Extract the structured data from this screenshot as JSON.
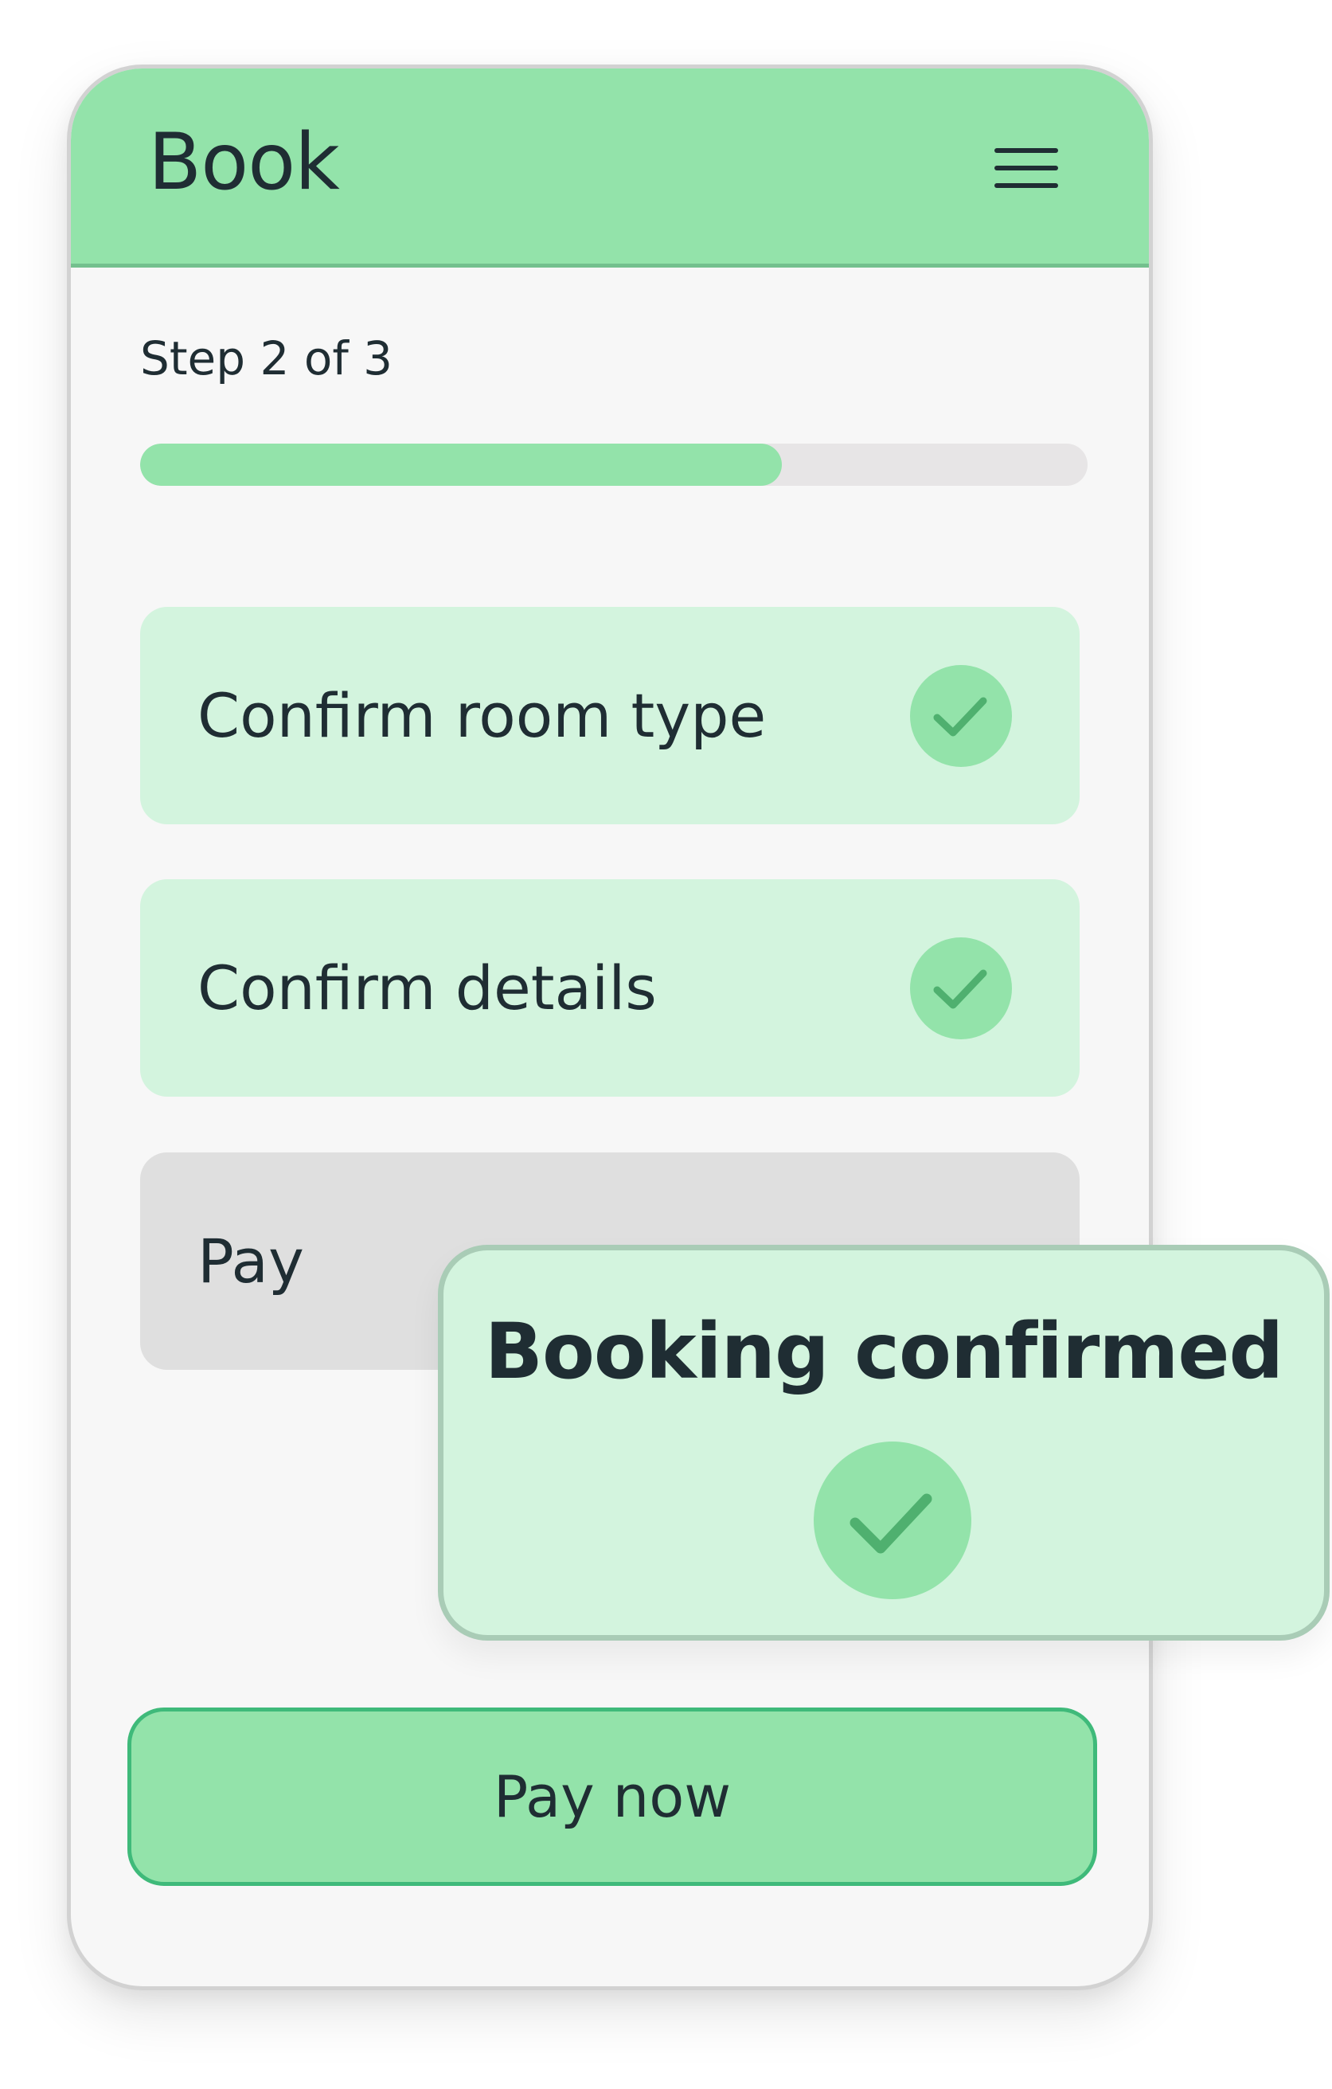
{
  "header": {
    "title": "Book",
    "menu_icon": "hamburger-menu-icon"
  },
  "progress": {
    "label": "Step 2 of 3",
    "current_step": 2,
    "total_steps": 3,
    "fill_fraction": 0.677
  },
  "steps": [
    {
      "label": "Confirm room type",
      "status": "complete",
      "icon": "check-icon"
    },
    {
      "label": "Confirm details",
      "status": "complete",
      "icon": "check-icon"
    },
    {
      "label": "Pay",
      "status": "pending"
    }
  ],
  "toast": {
    "title": "Booking confirmed",
    "icon": "check-icon"
  },
  "primary_action": {
    "label": "Pay now"
  },
  "colors": {
    "accent_green": "#93e3aa",
    "light_green": "#d3f4de",
    "check_stroke": "#4fb06f",
    "button_border": "#3fba7a",
    "pending_gray": "#dfdfdf",
    "track_gray": "#e7e5e6",
    "text_dark": "#1f2d33"
  }
}
